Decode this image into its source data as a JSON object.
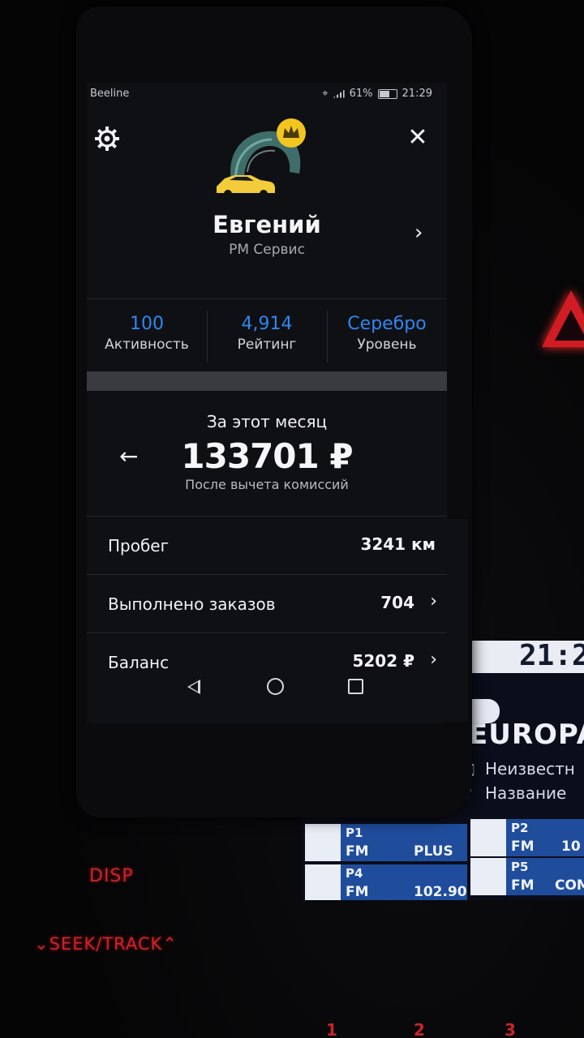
{
  "status_bar": {
    "carrier": "Beeline",
    "battery": "61%",
    "time": "21:29"
  },
  "profile": {
    "name": "Евгений",
    "company": "РМ Сервис"
  },
  "stats": [
    {
      "value": "100",
      "label": "Активность"
    },
    {
      "value": "4,914",
      "label": "Рейтинг"
    },
    {
      "value": "Серебро",
      "label": "Уровень"
    }
  ],
  "earnings": {
    "period": "За этот месяц",
    "amount": "133701 ₽",
    "note": "После вычета комиссий"
  },
  "rows": [
    {
      "label": "Пробег",
      "value": "3241 км"
    },
    {
      "label": "Выполнено заказов",
      "value": "704"
    },
    {
      "label": "Баланс",
      "value": "5202 ₽"
    }
  ],
  "background": {
    "console_labels": [
      "DISP",
      "SEEK/TRACK"
    ],
    "radio": {
      "clock": "21:2",
      "station": "EUROPA",
      "line1": "Неизвестн",
      "line2": "Название",
      "presets": [
        {
          "num": "P1",
          "band": "FM",
          "value": "PLUS"
        },
        {
          "num": "P2",
          "band": "FM",
          "value": "10"
        },
        {
          "num": "P4",
          "band": "FM",
          "value": "102.90"
        },
        {
          "num": "P5",
          "band": "FM",
          "value": "COM"
        }
      ]
    },
    "keys": [
      "1",
      "2",
      "3"
    ]
  },
  "colors": {
    "accent_blue": "#2f86f0",
    "crown_yellow": "#f2c521",
    "car_yellow": "#f3cc3b",
    "console_red": "#c8252a"
  },
  "icons": {
    "settings": "gear-icon",
    "close": "close-icon",
    "back": "arrow-left-icon",
    "chevron": "chevron-right-icon",
    "crown": "crown-icon"
  }
}
